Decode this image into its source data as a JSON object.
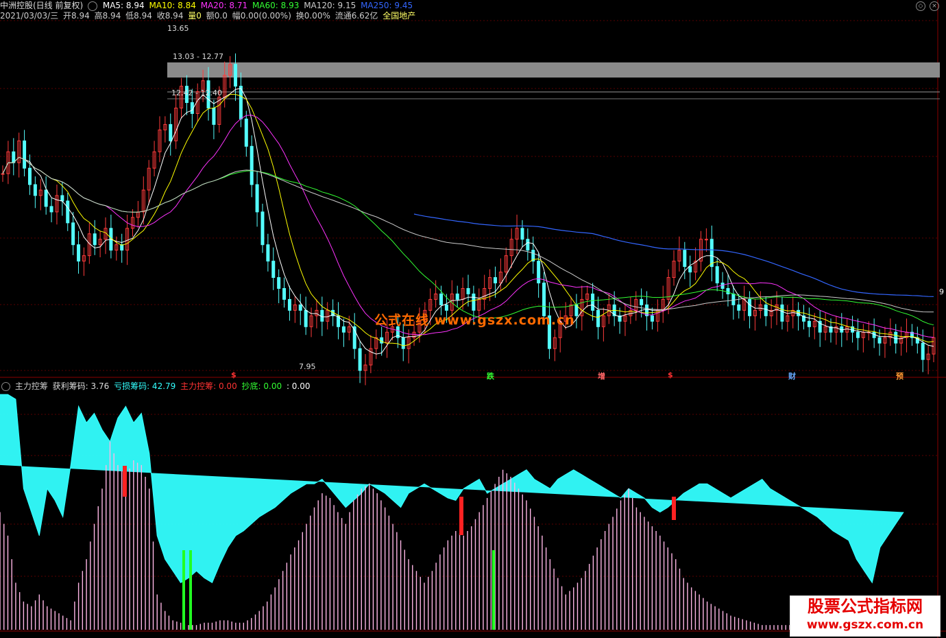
{
  "header": {
    "stock": "中洲控股(日线 前复权)",
    "ma": [
      {
        "label": "MA5: 8.94",
        "color": "#ffffff"
      },
      {
        "label": "MA10: 8.84",
        "color": "#ffff00"
      },
      {
        "label": "MA20: 8.71",
        "color": "#ff33ff"
      },
      {
        "label": "MA60: 8.93",
        "color": "#33ff33"
      },
      {
        "label": "MA120: 9.15",
        "color": "#cccccc"
      },
      {
        "label": "MA250: 9.45",
        "color": "#3366ff"
      }
    ],
    "quote": [
      {
        "label": "2021/03/03/三",
        "color": "#cccccc"
      },
      {
        "label": "开8.94",
        "color": "#cccccc"
      },
      {
        "label": "高8.94",
        "color": "#cccccc"
      },
      {
        "label": "低8.94",
        "color": "#cccccc"
      },
      {
        "label": "收8.94",
        "color": "#cccccc"
      },
      {
        "label": "量0",
        "color": "#ffff66"
      },
      {
        "label": "额0.0",
        "color": "#cccccc"
      },
      {
        "label": "幅0.00(0.00%)",
        "color": "#cccccc"
      },
      {
        "label": "换0.00%",
        "color": "#cccccc"
      },
      {
        "label": "流通6.62亿",
        "color": "#cccccc"
      },
      {
        "label": "全国地产",
        "color": "#ffff66"
      }
    ]
  },
  "price_annotations": {
    "high": "13.65",
    "zone_top": "13.03 - 12.77",
    "zone_bottom": "12.42 - 12.40",
    "low": "7.95",
    "right_tag": "9"
  },
  "signals": [
    {
      "label": "$",
      "color": "#ff3333"
    },
    {
      "label": "跌",
      "color": "#33ff33"
    },
    {
      "label": "增",
      "color": "#ff6666"
    },
    {
      "label": "$",
      "color": "#ff3333"
    },
    {
      "label": "财",
      "color": "#66aaff"
    },
    {
      "label": "预",
      "color": "#ff9933"
    }
  ],
  "indicator_header": [
    {
      "label": "主力控筹",
      "color": "#cccccc"
    },
    {
      "label": "获利筹码: 3.76",
      "color": "#dddddd"
    },
    {
      "label": "亏损筹码: 42.79",
      "color": "#33ffff"
    },
    {
      "label": "主力控筹: 0.00",
      "color": "#ff3333"
    },
    {
      "label": "抄底: 0.00",
      "color": "#33ff33"
    },
    {
      "label": ": 0.00",
      "color": "#ffffff"
    }
  ],
  "watermarks": {
    "center": "公式在线  www.gszx.com.cn",
    "corner_line1": "股票公式指标网",
    "corner_line2": "www.gszx.com.cn"
  },
  "chart_data": [
    {
      "type": "candlestick",
      "title": "中洲控股(日线 前复权)",
      "ylim": [
        7.6,
        14.0
      ],
      "close": [
        11.2,
        11.6,
        11.4,
        11.8,
        11.3,
        11.0,
        10.8,
        10.9,
        10.6,
        10.5,
        10.8,
        10.7,
        10.3,
        9.9,
        9.6,
        9.7,
        10.1,
        9.9,
        10.0,
        10.2,
        9.8,
        9.9,
        9.8,
        10.2,
        10.4,
        10.5,
        10.9,
        11.3,
        11.6,
        12.0,
        12.1,
        11.8,
        12.4,
        12.8,
        12.5,
        12.3,
        12.7,
        12.9,
        12.4,
        12.1,
        12.6,
        13.0,
        13.2,
        12.8,
        12.2,
        11.7,
        11.0,
        10.5,
        9.9,
        9.6,
        9.3,
        9.1,
        8.9,
        8.7,
        8.8,
        8.7,
        8.4,
        8.6,
        8.7,
        8.5,
        8.7,
        8.6,
        8.4,
        8.3,
        8.4,
        8.0,
        7.6,
        7.7,
        8.0,
        8.2,
        8.1,
        8.3,
        8.4,
        8.2,
        8.0,
        8.2,
        8.3,
        8.5,
        8.7,
        8.9,
        9.0,
        8.8,
        8.7,
        9.0,
        8.9,
        9.1,
        9.0,
        8.7,
        8.9,
        9.1,
        9.3,
        9.2,
        9.4,
        9.7,
        10.0,
        10.2,
        10.0,
        9.8,
        9.6,
        9.2,
        8.6,
        8.0,
        8.2,
        8.5,
        8.6,
        8.8,
        8.6,
        8.9,
        9.0,
        8.7,
        8.4,
        8.6,
        8.8,
        8.6,
        8.5,
        8.6,
        8.7,
        8.9,
        8.8,
        8.6,
        8.5,
        8.7,
        8.9,
        9.3,
        9.6,
        9.8,
        9.5,
        9.4,
        9.6,
        10.0,
        10.0,
        9.5,
        9.2,
        9.1,
        9.0,
        8.8,
        8.7,
        8.9,
        8.6,
        8.7,
        8.8,
        8.6,
        8.7,
        8.8,
        8.5,
        8.6,
        8.7,
        8.6,
        8.5,
        8.4,
        8.5,
        8.3,
        8.4,
        8.3,
        8.4,
        8.3,
        8.4,
        8.3,
        8.2,
        8.3,
        8.3,
        8.2,
        8.1,
        8.2,
        8.3,
        8.1,
        8.2,
        8.3,
        8.2,
        8.1,
        7.8,
        7.9,
        8.2
      ],
      "ma_values": {
        "MA5": 8.94,
        "MA10": 8.84,
        "MA20": 8.71,
        "MA60": 8.93,
        "MA120": 9.15,
        "MA250": 9.45
      },
      "annotations": [
        "13.65",
        "13.03 - 12.77",
        "12.42 - 12.40",
        "7.95"
      ]
    },
    {
      "type": "area",
      "title": "主力控筹",
      "ylim": [
        0,
        100
      ],
      "series": [
        {
          "name": "获利筹码",
          "values": [
            50,
            40,
            20,
            12,
            10,
            15,
            10,
            8,
            6,
            4,
            20,
            30,
            45,
            60,
            80,
            70,
            65,
            72,
            70,
            60,
            15,
            8,
            4,
            3,
            2,
            2,
            3,
            3,
            4,
            4,
            3,
            3,
            5,
            8,
            12,
            18,
            25,
            32,
            38,
            45,
            52,
            58,
            56,
            50,
            45,
            55,
            60,
            62,
            58,
            52,
            45,
            38,
            30,
            25,
            20,
            25,
            32,
            38,
            42,
            40,
            44,
            50,
            56,
            62,
            68,
            65,
            60,
            55,
            48,
            40,
            30,
            22,
            15,
            18,
            22,
            28,
            35,
            42,
            48,
            55,
            60,
            52,
            48,
            44,
            40,
            35,
            30,
            22,
            18,
            15,
            12,
            10,
            8,
            6,
            5,
            4,
            3,
            2,
            2,
            2,
            2,
            2,
            2,
            2,
            2,
            3,
            3,
            2,
            2,
            2,
            2,
            2,
            2,
            3,
            4,
            5,
            6,
            5,
            4,
            3
          ]
        },
        {
          "name": "亏损筹码",
          "values": [
            100,
            100,
            98,
            60,
            50,
            40,
            60,
            55,
            48,
            70,
            95,
            88,
            92,
            85,
            80,
            90,
            95,
            88,
            92,
            75,
            40,
            30,
            25,
            20,
            22,
            25,
            22,
            20,
            28,
            35,
            40,
            42,
            45,
            48,
            50,
            52,
            55,
            58,
            60,
            62,
            62,
            64,
            60,
            56,
            52,
            55,
            58,
            62,
            60,
            58,
            55,
            52,
            58,
            60,
            62,
            60,
            58,
            56,
            55,
            60,
            62,
            64,
            58,
            60,
            62,
            64,
            66,
            68,
            64,
            62,
            60,
            64,
            66,
            68,
            66,
            64,
            62,
            60,
            58,
            56,
            60,
            58,
            56,
            52,
            50,
            52,
            55,
            58,
            60,
            62,
            62,
            60,
            58,
            56,
            58,
            60,
            62,
            64,
            60,
            58,
            56,
            54,
            52,
            50,
            48,
            45,
            42,
            40,
            38,
            30,
            25,
            20,
            35,
            40,
            45,
            50
          ]
        }
      ]
    }
  ]
}
